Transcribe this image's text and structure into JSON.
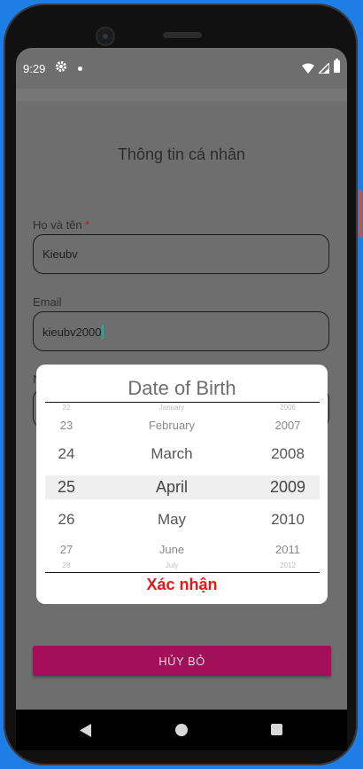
{
  "status_bar": {
    "time": "9:29"
  },
  "form": {
    "title": "Thông tin cá nhân",
    "name_label": "Họ và tên",
    "required_mark": "*",
    "name_value": "Kieubv",
    "email_label": "Email",
    "email_value": "kieubv2000",
    "third_label_fragment": "N"
  },
  "dialog": {
    "title": "Date of Birth",
    "days": [
      "22",
      "23",
      "24",
      "25",
      "26",
      "27",
      "28"
    ],
    "months": [
      "January",
      "February",
      "March",
      "April",
      "May",
      "June",
      "July"
    ],
    "years": [
      "2006",
      "2007",
      "2008",
      "2009",
      "2010",
      "2011",
      "2012"
    ],
    "selected": {
      "day": "25",
      "month": "April",
      "year": "2009"
    },
    "confirm_label": "Xác nhận"
  },
  "cancel_button": {
    "label": "HỦY BỎ"
  },
  "colors": {
    "cancel_button": "#E6117F",
    "confirm_text": "#E11919",
    "background": "#1F7EE6"
  }
}
